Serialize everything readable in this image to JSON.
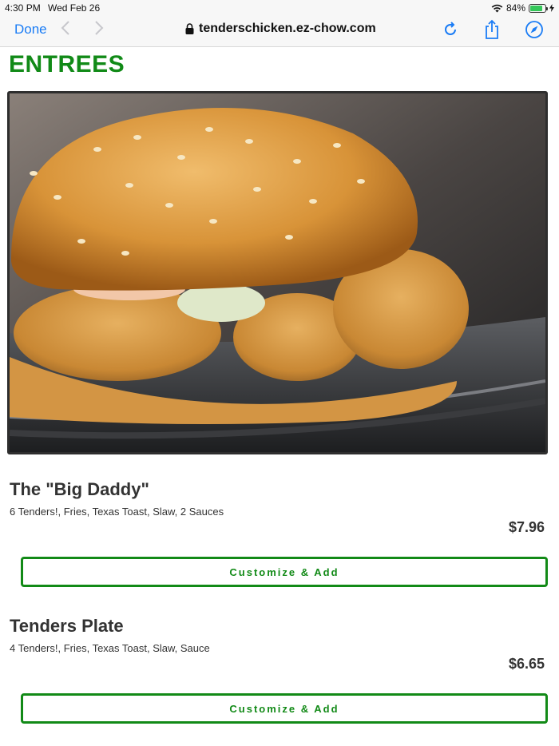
{
  "status_bar": {
    "time": "4:30 PM",
    "date": "Wed Feb 26",
    "battery": "84%",
    "battery_level": 0.84,
    "icons": [
      "wifi-icon",
      "battery-icon",
      "charging-icon"
    ]
  },
  "browser": {
    "done_label": "Done",
    "url": "tenderschicken.ez-chow.com",
    "icons": [
      "back-chevron-icon",
      "forward-chevron-icon",
      "lock-icon",
      "reload-icon",
      "share-icon",
      "compass-icon"
    ],
    "accent_color": "#1a7cf5"
  },
  "menu": {
    "section_title": "ENTREES",
    "brand_color": "#118a17",
    "items": [
      {
        "name": "The \"Big Daddy\"",
        "description": "6 Tenders!, Fries, Texas Toast, Slaw, 2 Sauces",
        "price": "$7.96",
        "button_label": "Customize & Add"
      },
      {
        "name": "Tenders Plate",
        "description": "4 Tenders!, Fries, Texas Toast, Slaw, Sauce",
        "price": "$6.65",
        "button_label": "Customize & Add"
      }
    ]
  }
}
